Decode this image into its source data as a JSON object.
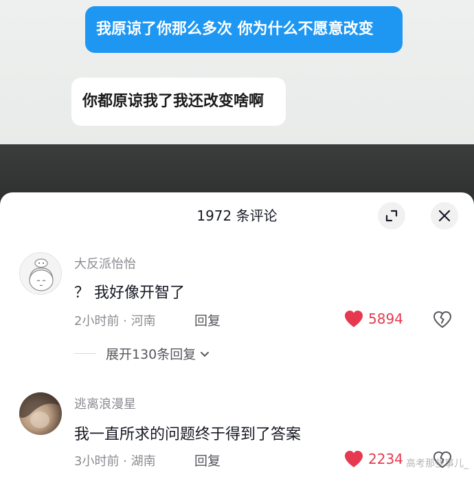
{
  "chat": {
    "sent_message": "我原谅了你那么多次 你为什么不愿意改变",
    "received_message": "你都原谅我了我还改变啥啊"
  },
  "comments_panel": {
    "title": "1972 条评论",
    "expand_icon": "expand-icon",
    "close_icon": "close-icon",
    "comments": [
      {
        "username": "大反派怡怡",
        "text": "？ 我好像开智了",
        "time_location": "2小时前 · 河南",
        "reply_label": "回复",
        "likes": "5894",
        "expand_replies": "展开130条回复"
      },
      {
        "username": "逃离浪漫星",
        "text": "我一直所求的问题终于得到了答案",
        "time_location": "3小时前 · 湖南",
        "reply_label": "回复",
        "likes": "2234"
      }
    ]
  },
  "colors": {
    "sent_bubble": "#1e97f3",
    "like_red": "#e6394f",
    "meta_gray": "#8a8b91"
  },
  "watermark": "高考那些事儿_"
}
